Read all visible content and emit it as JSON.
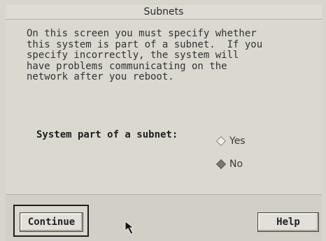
{
  "window": {
    "title": "Subnets"
  },
  "main": {
    "message_lines": [
      "On this screen you must specify whether",
      "this system is part of a subnet.  If you",
      "specify incorrectly, the system will",
      "have problems communicating on the",
      "network after you reboot."
    ],
    "question_label": "System part of a subnet:",
    "options": [
      {
        "label": "Yes",
        "selected": false
      },
      {
        "label": "No",
        "selected": true
      }
    ]
  },
  "footer": {
    "continue_label": "Continue",
    "help_label": "Help"
  }
}
